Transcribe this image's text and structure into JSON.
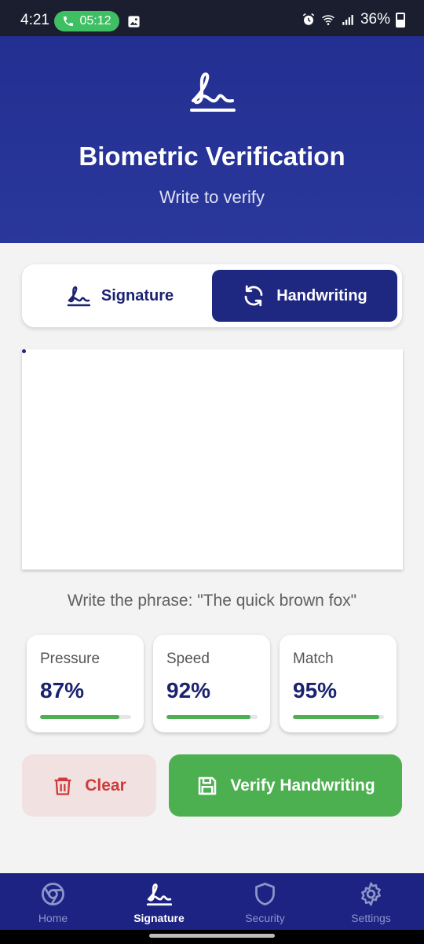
{
  "status_bar": {
    "time": "4:21",
    "call_duration": "05:12",
    "battery": "36%"
  },
  "header": {
    "title": "Biometric Verification",
    "subtitle": "Write to verify"
  },
  "mode_toggle": {
    "signature_label": "Signature",
    "handwriting_label": "Handwriting",
    "selected": "Handwriting"
  },
  "canvas": {
    "prompt": "Write the phrase: \"The quick brown fox\""
  },
  "metrics": [
    {
      "label": "Pressure",
      "value": "87%",
      "level": 0.87
    },
    {
      "label": "Speed",
      "value": "92%",
      "level": 0.92
    },
    {
      "label": "Match",
      "value": "95%",
      "level": 0.95
    }
  ],
  "actions": {
    "clear_label": "Clear",
    "verify_label": "Verify Handwriting"
  },
  "bottom_nav": {
    "items": [
      {
        "label": "Home",
        "icon": "chrome-icon"
      },
      {
        "label": "Signature",
        "icon": "signature-icon",
        "active": true
      },
      {
        "label": "Security",
        "icon": "shield-icon"
      },
      {
        "label": "Settings",
        "icon": "gear-icon"
      }
    ]
  },
  "colors": {
    "primary": "#1e2880",
    "header": "#232f91",
    "success": "#4caf50",
    "danger": "#d13a3a",
    "danger_bg": "#f2e1e1"
  }
}
